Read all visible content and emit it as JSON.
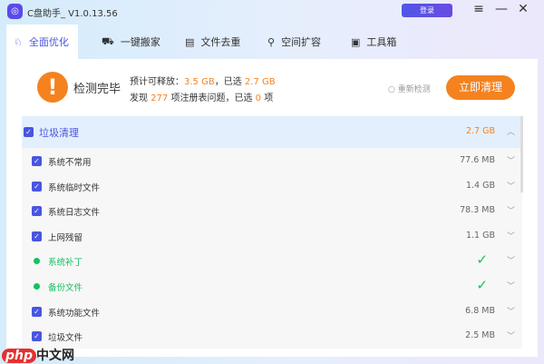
{
  "app": {
    "title": "C盘助手_ V1.0.13.56",
    "login": "登录",
    "menu_icon": "≡",
    "min_icon": "—",
    "close_icon": "✕"
  },
  "tabs": [
    {
      "label": "全面优化",
      "icon": "rocket-icon"
    },
    {
      "label": "一键搬家",
      "icon": "truck-icon"
    },
    {
      "label": "文件去重",
      "icon": "file-icon"
    },
    {
      "label": "空间扩容",
      "icon": "expand-icon"
    },
    {
      "label": "工具箱",
      "icon": "toolbox-icon"
    }
  ],
  "summary": {
    "status": "检测完毕",
    "line1_prefix": "预计可释放：",
    "release": "3.5 GB",
    "line1_mid": "，已选",
    "selected": "2.7 GB",
    "line2_prefix": "发现",
    "issues": "277",
    "line2_mid": "项注册表问题，已选",
    "issues_selected": "0",
    "line2_suffix": "项",
    "rescan": "重新检测",
    "clean": "立即清理"
  },
  "list": {
    "group": {
      "label": "垃圾清理",
      "size": "2.7 GB"
    },
    "items": [
      {
        "label": "系统不常用",
        "size": "77.6 MB",
        "type": "check"
      },
      {
        "label": "系统临时文件",
        "size": "1.4 GB",
        "type": "check"
      },
      {
        "label": "系统日志文件",
        "size": "78.3 MB",
        "type": "check"
      },
      {
        "label": "上网残留",
        "size": "1.1 GB",
        "type": "check"
      },
      {
        "label": "系统补丁",
        "size": "",
        "type": "ok"
      },
      {
        "label": "备份文件",
        "size": "",
        "type": "ok"
      },
      {
        "label": "系统功能文件",
        "size": "6.8 MB",
        "type": "check"
      },
      {
        "label": "垃圾文件",
        "size": "2.5 MB",
        "type": "check"
      }
    ]
  },
  "watermark": {
    "a": "php",
    "b": "中文网"
  },
  "colors": {
    "accent": "#4a55e0",
    "orange": "#f5821f",
    "green": "#14c15f"
  }
}
